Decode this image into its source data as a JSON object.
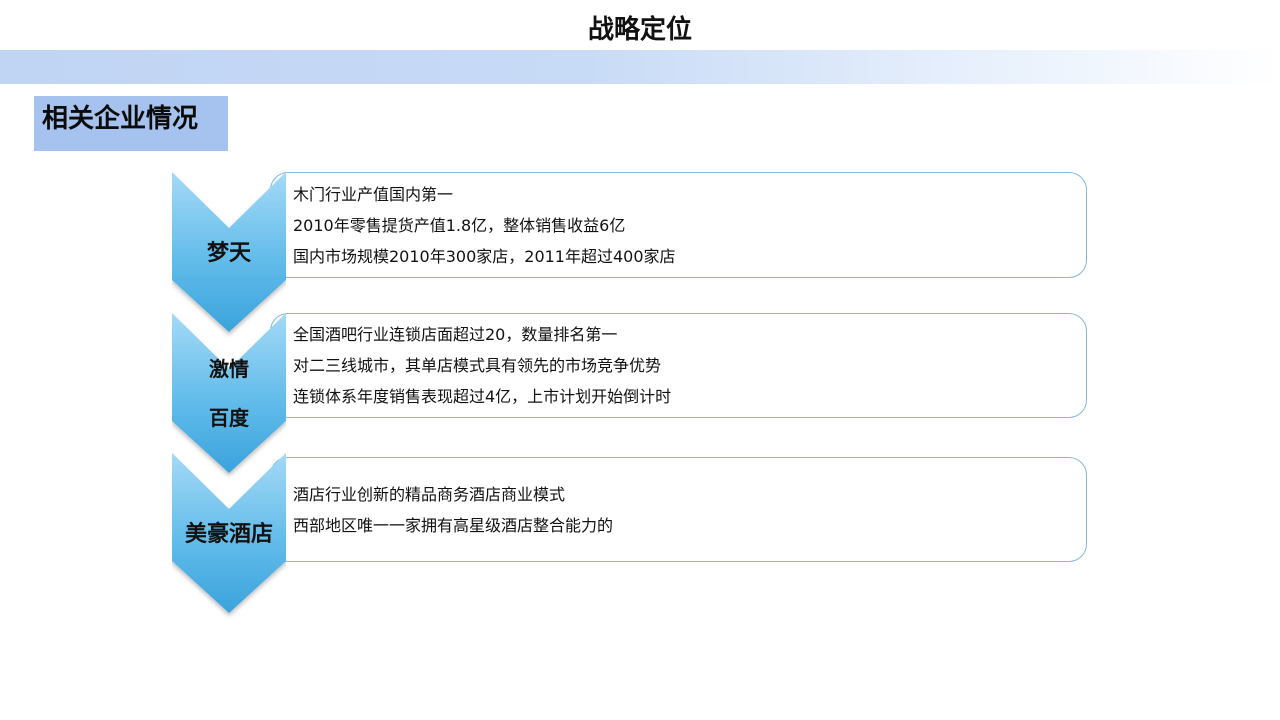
{
  "title": "战略定位",
  "section": "相关企业情况",
  "bullet_glyph": "•",
  "colors": {
    "band_start": "#c0d4f4",
    "label_bg": "#a6c2ee",
    "chevron_top": "#9fd6f6",
    "chevron_bottom": "#3aa5de",
    "box_border": "#7fb8e0"
  },
  "companies": [
    {
      "name": "梦天",
      "items": [
        "木门行业产值国内第一",
        "2010年零售提货产值1.8亿，整体销售收益6亿",
        "国内市场规模2010年300家店，2011年超过400家店"
      ]
    },
    {
      "name_lines": [
        "激情",
        "百度"
      ],
      "items": [
        "全国酒吧行业连锁店面超过20，数量排名第一",
        "对二三线城市，其单店模式具有领先的市场竞争优势",
        "连锁体系年度销售表现超过4亿，上市计划开始倒计时"
      ]
    },
    {
      "name": "美豪酒店",
      "items": [
        "酒店行业创新的精品商务酒店商业模式",
        "西部地区唯一一家拥有高星级酒店整合能力的"
      ]
    }
  ]
}
